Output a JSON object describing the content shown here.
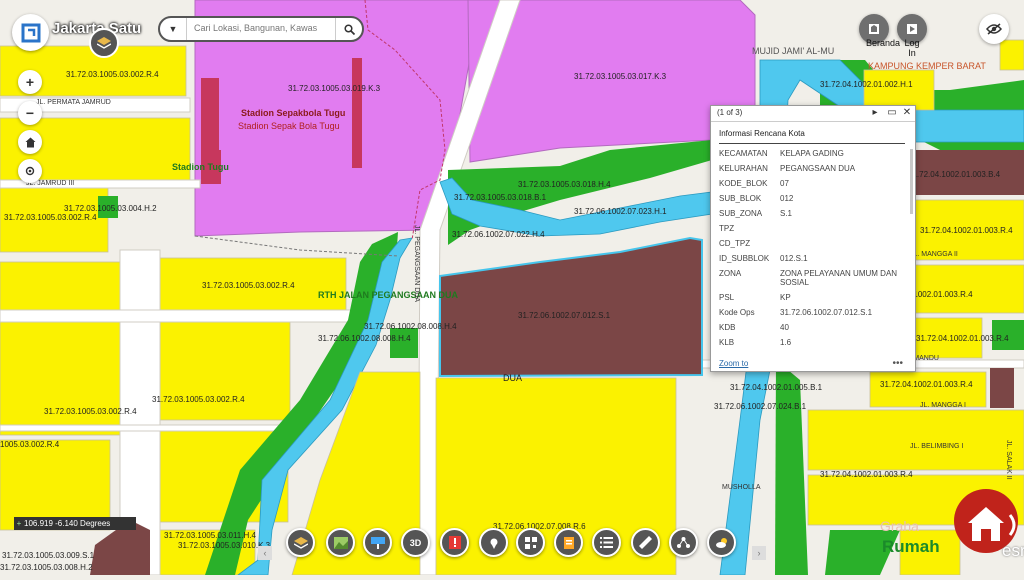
{
  "app": {
    "title": "Jakarta Satu"
  },
  "search": {
    "placeholder": "Cari Lokasi, Bangunan, Kawas"
  },
  "header_right": {
    "beranda_label": "Beranda",
    "login_label": "Log In"
  },
  "popup": {
    "count": "(1 of 3)",
    "title": "Informasi Rencana Kota",
    "rows": [
      {
        "k": "KECAMATAN",
        "v": "KELAPA GADING"
      },
      {
        "k": "KELURAHAN",
        "v": "PEGANGSAAN DUA"
      },
      {
        "k": "KODE_BLOK",
        "v": "07"
      },
      {
        "k": "SUB_BLOK",
        "v": "012"
      },
      {
        "k": "SUB_ZONA",
        "v": "S.1"
      },
      {
        "k": "TPZ",
        "v": ""
      },
      {
        "k": "CD_TPZ",
        "v": ""
      },
      {
        "k": "ID_SUBBLOK",
        "v": "012.S.1"
      },
      {
        "k": "ZONA",
        "v": "ZONA PELAYANAN UMUM DAN SOSIAL"
      },
      {
        "k": "PSL",
        "v": "KP"
      },
      {
        "k": "Kode Ops",
        "v": "31.72.06.1002.07.012.S.1"
      },
      {
        "k": "KDB",
        "v": "40"
      },
      {
        "k": "KLB",
        "v": "1.6"
      }
    ],
    "zoom_label": "Zoom to",
    "more": "•••"
  },
  "coordinates": "106.919 -6.140 Degrees",
  "brand": {
    "line1": "Graha",
    "line2": "Rumah"
  },
  "esri": "esri",
  "colors": {
    "residential": "#fbf200",
    "social": "#e17cf0",
    "water": "#4fc8ee",
    "green": "#2ab02a",
    "public": "#7b4646",
    "road": "#ffffff"
  },
  "map_labels": {
    "l1": "31.72.03.1005.03.002.R.4",
    "l2": "JL. PERMATA JAMRUD",
    "l3": "31.72.03.1005.03.019.K.3",
    "l4": "Stadion Sepakbola Tugu",
    "l5": "Stadion Sepak Bola Tugu",
    "l6": "Stadion Tugu",
    "l7": "JL. JAMRUD III",
    "l8": "31.72.03.1005.03.004.H.2",
    "l9": "31.72.03.1005.03.002.R.4",
    "l10": "31.72.03.1005.03.002.R.4",
    "l11": "RTH JALAN PEGANGSAAN DUA",
    "l12": "31.72.06.1002.08.008.H.4",
    "l13": "31.72.06.1002.08.008.H.4",
    "l14": "31.72.03.1005.03.002.R.4",
    "l15": "31.72.03.1005.03.002.R.4",
    "l16": "1005.03.002.R.4",
    "l17": "31.72.03.1005.03.017.K.3",
    "l18": "31.72.03.1005.03.018.H.4",
    "l19": "31.72.03.1005.03.018.B.1",
    "l20": "31.72.06.1002.07.023.H.1",
    "l21": "31.72.06.1002.07.022.H.4",
    "l22": "31.72.06.1002.07.012.S.1",
    "l23": "DUA",
    "l24": "MUJID JAMI' AL-MU",
    "l25": "KAMPUNG KEMPER BARAT",
    "l26": "31.72.04.1002.01.002.H.1",
    "l27": "31.72.04.1002.01.003.B.4",
    "l28": "31.72.04.1002.01.003.R.4",
    "l29": "31.72.04.1002.01.003.R.4",
    "l30": "31.72.04.1002.01.003.R.4",
    "l31": "31.72.04.1002.01.003.R.4",
    "l32": "31.72.04.1002.01.003.R.4",
    "l33": "31.72.04.1002.01.005.B.1",
    "l34": "31.72.06.1002.07.024.B.1",
    "l35": "31.72.06.1002.07.008.R.6",
    "l36": "31.72.03.1005.03.011.H.4",
    "l37": "31.72.03.1005.03.010.K.3",
    "l38": "31.72.03.1005.03.009.S.1",
    "l39": "31.72.03.1005.03.008.H.2",
    "l40": "JL. PEGANGSAAN DUA",
    "l41": "MUSHOLLA",
    "l42": "JL. MANGGA II",
    "l43": "JL. MANGGA I",
    "l44": "JL. MANDU",
    "l45": "JL. BELIMBING I",
    "l46": "JL. SALAK II"
  }
}
